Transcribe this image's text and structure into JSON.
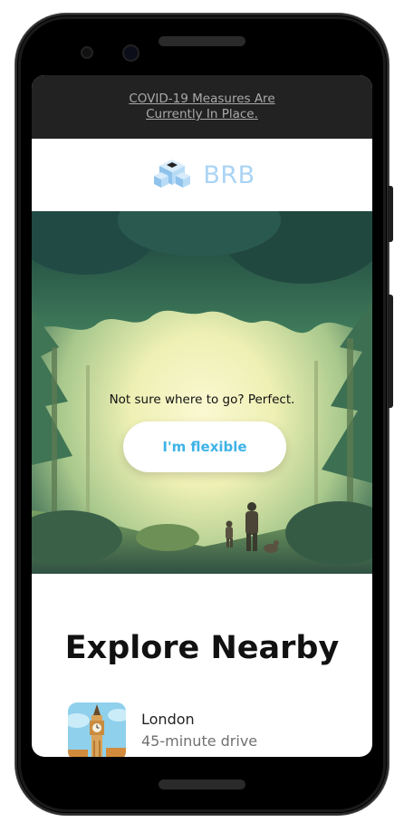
{
  "covid_banner": {
    "text": "COVID-19 Measures Are Currently In Place."
  },
  "brand": {
    "name": "BRB",
    "color": "#a9d4f5"
  },
  "hero": {
    "tagline": "Not sure where to go? Perfect.",
    "button_label": "I'm flexible",
    "button_color": "#3fb3e6"
  },
  "explore": {
    "title": "Explore Nearby",
    "items": [
      {
        "name": "London",
        "subtitle": "45-minute drive",
        "icon": "big-ben-thumbnail"
      }
    ]
  }
}
